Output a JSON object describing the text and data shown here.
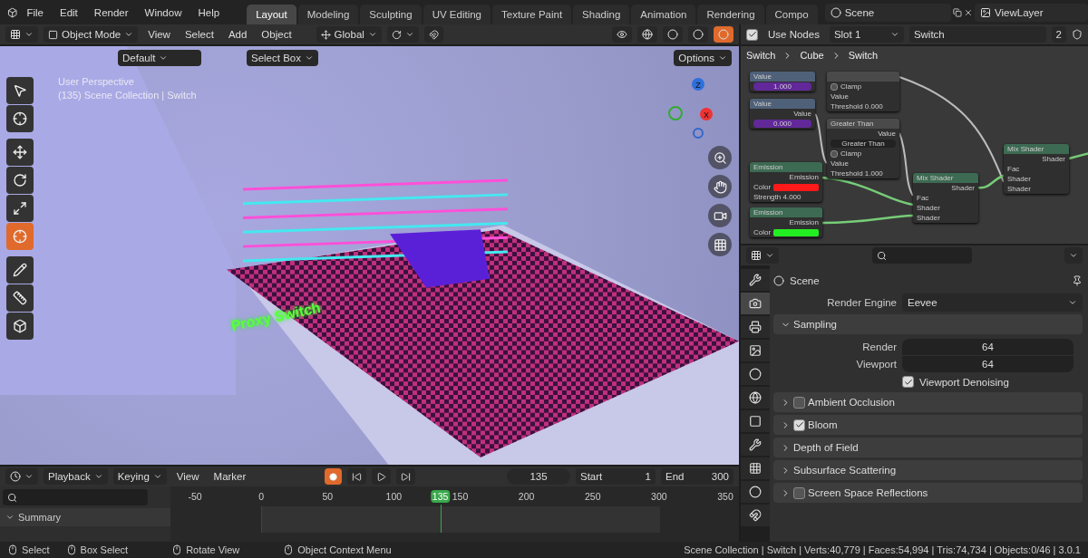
{
  "menu": [
    "File",
    "Edit",
    "Render",
    "Window",
    "Help"
  ],
  "workspaces": [
    {
      "label": "Layout",
      "selected": true
    },
    {
      "label": "Modeling",
      "selected": false
    },
    {
      "label": "Sculpting",
      "selected": false
    },
    {
      "label": "UV Editing",
      "selected": false
    },
    {
      "label": "Texture Paint",
      "selected": false
    },
    {
      "label": "Shading",
      "selected": false
    },
    {
      "label": "Animation",
      "selected": false
    },
    {
      "label": "Rendering",
      "selected": false
    },
    {
      "label": "Compo",
      "selected": false
    }
  ],
  "scene": {
    "name": "Scene"
  },
  "view_layer": {
    "name": "ViewLayer"
  },
  "viewport_header": {
    "mode": "Object Mode",
    "menus": [
      "View",
      "Select",
      "Add",
      "Object"
    ],
    "orientation": "Global",
    "shading": [
      {
        "kind": "wireframe",
        "selected": false
      },
      {
        "kind": "solid",
        "selected": false
      },
      {
        "kind": "material",
        "selected": false
      },
      {
        "kind": "rendered",
        "selected": true
      }
    ]
  },
  "tool_settings": {
    "pivot": "Default",
    "select_mode": "Select Box",
    "options": "Options"
  },
  "tools": [
    {
      "kind": "select",
      "selected": false
    },
    {
      "kind": "cursor",
      "selected": false
    },
    {
      "kind": "move",
      "selected": false
    },
    {
      "kind": "rotate",
      "selected": false
    },
    {
      "kind": "scale",
      "selected": false
    },
    {
      "kind": "transform",
      "selected": true
    },
    {
      "kind": "annotate",
      "selected": false
    },
    {
      "kind": "measure",
      "selected": false
    },
    {
      "kind": "add_cube",
      "selected": false
    }
  ],
  "viewport": {
    "overlay_lines": [
      "User Perspective",
      "(135) Scene Collection | Switch"
    ],
    "scene_text": "Proxy Switch",
    "gizmo_axes": [
      "Z",
      "X"
    ]
  },
  "node_header": {
    "use_nodes": true,
    "use_nodes_label": "Use Nodes",
    "slot": "Slot 1",
    "material": "Switch",
    "users": "2"
  },
  "breadcrumbs": [
    "Switch",
    "Cube",
    "Switch"
  ],
  "nodes": [
    {
      "title": "Value",
      "kind": "value",
      "rows": [
        {
          "kind": "field",
          "label": "1.000"
        }
      ]
    },
    {
      "kind": "converter",
      "rows": [
        {
          "kind": "checkbox",
          "label": "Clamp",
          "checked": false
        },
        {
          "kind": "input",
          "label": "Value"
        },
        {
          "kind": "input",
          "label": "Threshold  0.000"
        }
      ]
    },
    {
      "title": "Greater Than",
      "kind": "converter",
      "rows": [
        {
          "kind": "output",
          "label": "Value"
        },
        {
          "kind": "dropdown",
          "label": "Greater Than"
        },
        {
          "kind": "checkbox",
          "label": "Clamp",
          "checked": false
        },
        {
          "kind": "input",
          "label": "Value"
        },
        {
          "kind": "input",
          "label": "Threshold  1.000"
        }
      ]
    },
    {
      "title": "Value",
      "kind": "value",
      "rows": [
        {
          "kind": "output",
          "label": "Value"
        },
        {
          "kind": "field",
          "label": "0.000"
        }
      ]
    },
    {
      "title": "Emission",
      "kind": "shader",
      "rows": [
        {
          "kind": "output",
          "label": "Emission"
        },
        {
          "kind": "color",
          "label": "Color",
          "color": "#ff1a1a"
        },
        {
          "kind": "input",
          "label": "Strength  4.000"
        }
      ]
    },
    {
      "title": "Emission",
      "kind": "shader",
      "rows": [
        {
          "kind": "output",
          "label": "Emission"
        },
        {
          "kind": "color",
          "label": "Color",
          "color": "#22ee22"
        }
      ]
    },
    {
      "title": "Mix Shader",
      "kind": "shader",
      "rows": [
        {
          "kind": "output",
          "label": "Shader"
        },
        {
          "kind": "input",
          "label": "Fac"
        },
        {
          "kind": "input",
          "label": "Shader"
        },
        {
          "kind": "input",
          "label": "Shader"
        }
      ]
    },
    {
      "title": "Mix Shader",
      "kind": "shader",
      "rows": [
        {
          "kind": "output",
          "label": "Shader"
        },
        {
          "kind": "input",
          "label": "Fac"
        },
        {
          "kind": "input",
          "label": "Shader"
        },
        {
          "kind": "input",
          "label": "Shader"
        }
      ]
    }
  ],
  "properties": {
    "tabs": [
      {
        "kind": "tool",
        "selected": false
      },
      {
        "kind": "render",
        "selected": true
      },
      {
        "kind": "output",
        "selected": false
      },
      {
        "kind": "view_layer",
        "selected": false
      },
      {
        "kind": "scene",
        "selected": false
      },
      {
        "kind": "world",
        "selected": false
      },
      {
        "kind": "object",
        "selected": false
      },
      {
        "kind": "modifier",
        "selected": false
      },
      {
        "kind": "particles",
        "selected": false
      },
      {
        "kind": "physics",
        "selected": false
      },
      {
        "kind": "constraints",
        "selected": false
      }
    ],
    "context": "Scene",
    "render_engine_label": "Render Engine",
    "render_engine": "Eevee",
    "panels": [
      {
        "label": "Sampling",
        "expanded": true,
        "fields": [
          {
            "label": "Render",
            "value": "64"
          },
          {
            "label": "Viewport",
            "value": "64"
          }
        ],
        "option": {
          "label": "Viewport Denoising",
          "checked": true
        }
      },
      {
        "label": "Ambient Occlusion",
        "expanded": false,
        "enabled": false
      },
      {
        "label": "Bloom",
        "expanded": false,
        "enabled": true
      },
      {
        "label": "Depth of Field",
        "expanded": false
      },
      {
        "label": "Subsurface Scattering",
        "expanded": false
      },
      {
        "label": "Screen Space Reflections",
        "expanded": false,
        "enabled": false
      }
    ]
  },
  "timeline": {
    "playback": "Playback",
    "keying": "Keying",
    "menus": [
      "View",
      "Marker"
    ],
    "auto_key": true,
    "current_frame": "135",
    "start_label": "Start",
    "start": "1",
    "end_label": "End",
    "end": "300",
    "ticks": [
      "-50",
      "0",
      "50",
      "100",
      "150",
      "200",
      "250",
      "300",
      "350"
    ],
    "playhead": "135",
    "channel": "Summary",
    "channel_expanded": true
  },
  "status_bar": {
    "hints": [
      "Select",
      "Box Select",
      "Rotate View",
      "Object Context Menu"
    ],
    "stats": "Scene Collection | Switch | Verts:40,779 | Faces:54,994 | Tris:74,734 | Objects:0/46 | 3.0.1"
  }
}
